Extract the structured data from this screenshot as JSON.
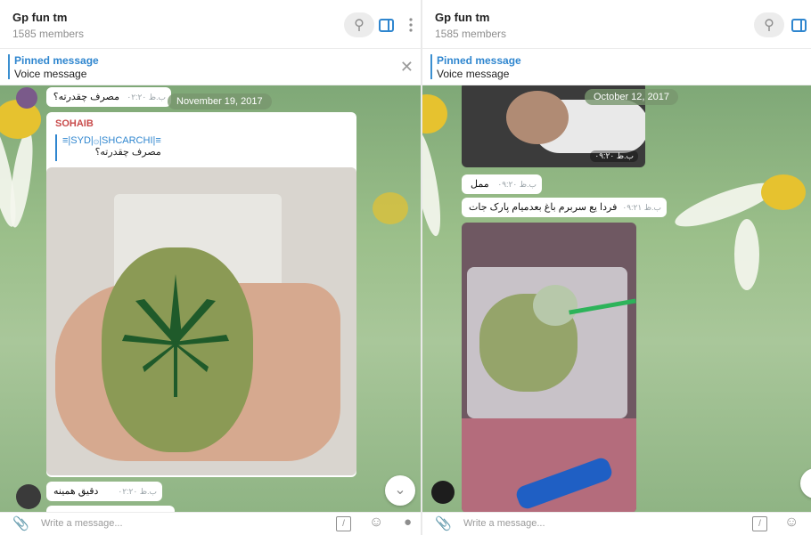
{
  "left": {
    "header": {
      "title": "Gp fun tm",
      "subtitle": "1585 members"
    },
    "pinned": {
      "title": "Pinned message",
      "text": "Voice message"
    },
    "date": "November 19, 2017",
    "top_bubble": {
      "text": "مصرف چقدرته؟",
      "time": "ب.ظ ۰۲:۲۰"
    },
    "reply_bubble": {
      "sender": "SOHAIB",
      "quote_name": "≡|SYD|۞|SHCARCHI|≡",
      "quote_text": "مصرف چقدرته؟"
    },
    "bottom_bubble": {
      "text": "دقیق همینه",
      "time": "ب.ظ ۰۲:۲۰"
    },
    "composer": {
      "placeholder": "Write a message..."
    }
  },
  "right": {
    "header": {
      "title": "Gp fun tm",
      "subtitle": "1585 members"
    },
    "pinned": {
      "title": "Pinned message",
      "text": "Voice message"
    },
    "date": "October 12, 2017",
    "photo_time": "ب.ظ ۰۹:۲۰",
    "bubble1": {
      "text": "ممل",
      "time": "ب.ظ ۰۹:۲۰"
    },
    "bubble2": {
      "text": "فردا یع سربرم باغ بعدمیام پارک جات",
      "time": "ب.ظ ۰۹:۲۱"
    },
    "composer": {
      "placeholder": "Write a message..."
    }
  },
  "colors": {
    "accent": "#2f86cf",
    "sender": "#c84a4a",
    "bg_green": "#9bbf8a"
  },
  "icons": [
    "search-icon",
    "panel-icon",
    "more-icon",
    "close-icon",
    "paperclip-icon",
    "command-icon",
    "emoji-icon",
    "microphone-icon",
    "chevron-down-icon"
  ]
}
